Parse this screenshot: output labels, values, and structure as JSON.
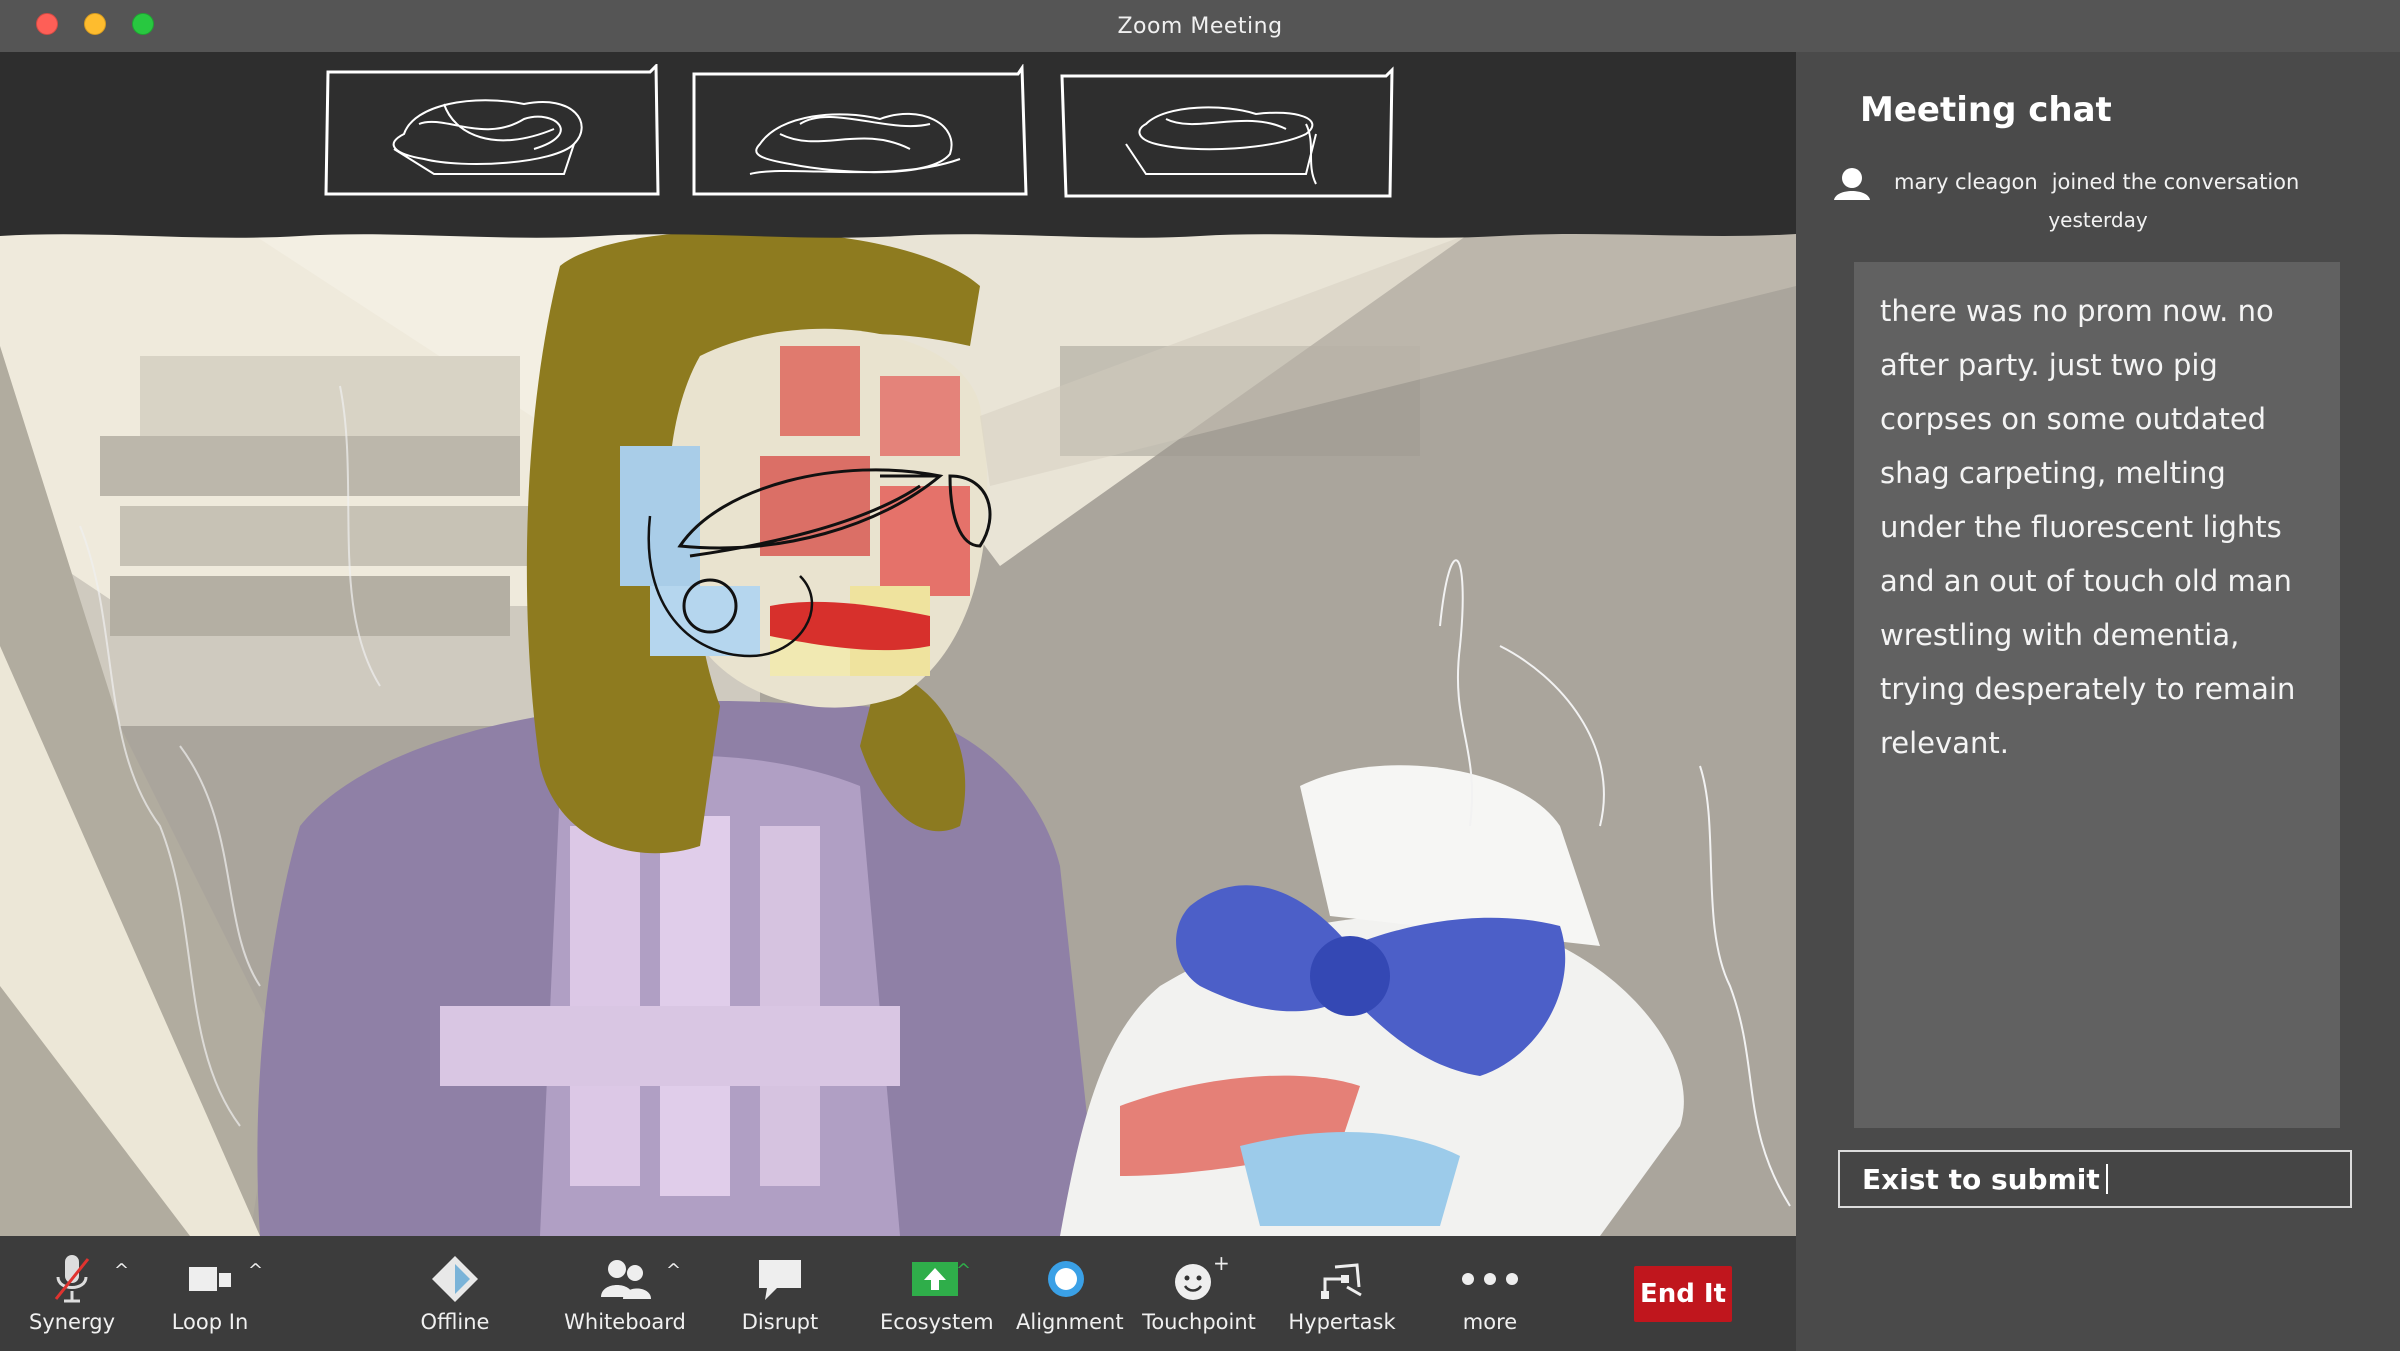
{
  "window": {
    "title": "Zoom Meeting"
  },
  "chat": {
    "title": "Meeting chat",
    "join_user": "mary cleagon",
    "join_action": "joined the conversation",
    "join_time": "yesterday",
    "message": "there was no prom now. no after party. just two pig corpses on some outdated shag carpeting, melting under the fluorescent lights and an out of touch old man wrestling with dementia, trying desperately to remain relevant.",
    "input_value": "Exist to submit"
  },
  "toolbar": {
    "items": [
      {
        "label": "Synergy",
        "icon": "muted-microphone-icon"
      },
      {
        "label": "Loop In",
        "icon": "video-camera-icon"
      },
      {
        "label": "Offline",
        "icon": "diamond-icon"
      },
      {
        "label": "Whiteboard",
        "icon": "participants-icon"
      },
      {
        "label": "Disrupt",
        "icon": "speech-bubble-icon"
      },
      {
        "label": "Ecosystem",
        "icon": "share-screen-icon"
      },
      {
        "label": "Alignment",
        "icon": "circle-icon"
      },
      {
        "label": "Touchpoint",
        "icon": "smiley-plus-icon"
      },
      {
        "label": "Hypertask",
        "icon": "sketch-icon"
      },
      {
        "label": "more",
        "icon": "more-dots-icon"
      }
    ],
    "end_label": "End It"
  },
  "colors": {
    "end_button": "#c0161d",
    "share_icon": "#2fae4a",
    "alignment_icon": "#3aa0e6"
  }
}
